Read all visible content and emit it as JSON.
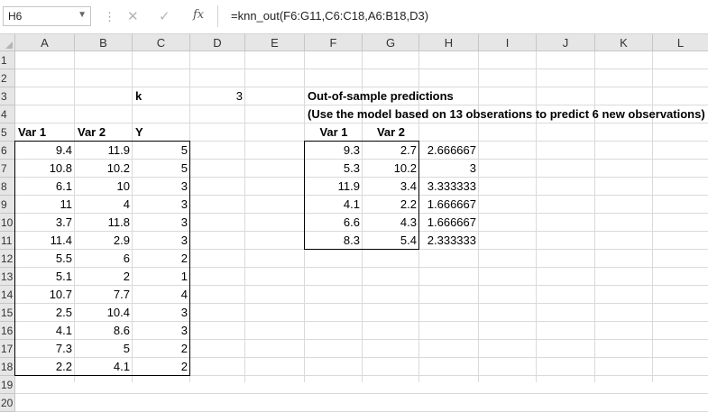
{
  "formula_bar": {
    "name_box": "H6",
    "cancel_icon": "✕",
    "enter_icon": "✓",
    "fx_label": "fx",
    "formula": "=knn_out(F6:G11,C6:C18,A6:B18,D3)"
  },
  "columns": [
    "A",
    "B",
    "C",
    "D",
    "E",
    "F",
    "G",
    "H",
    "I",
    "J",
    "K",
    "L"
  ],
  "rows": [
    "1",
    "2",
    "3",
    "4",
    "5",
    "6",
    "7",
    "8",
    "9",
    "10",
    "11",
    "12",
    "13",
    "14",
    "15",
    "16",
    "17",
    "18",
    "19",
    "20"
  ],
  "labels": {
    "k_label": "k",
    "k_value": "3",
    "title1": "Out-of-sample predictions",
    "title2": "(Use the model based on 13 obserations to predict 6 new observations)"
  },
  "training": {
    "headers": [
      "Var 1",
      "Var 2",
      "Y"
    ],
    "rows": [
      [
        "9.4",
        "11.9",
        "5"
      ],
      [
        "10.8",
        "10.2",
        "5"
      ],
      [
        "6.1",
        "10",
        "3"
      ],
      [
        "11",
        "4",
        "3"
      ],
      [
        "3.7",
        "11.8",
        "3"
      ],
      [
        "11.4",
        "2.9",
        "3"
      ],
      [
        "5.5",
        "6",
        "2"
      ],
      [
        "5.1",
        "2",
        "1"
      ],
      [
        "10.7",
        "7.7",
        "4"
      ],
      [
        "2.5",
        "10.4",
        "3"
      ],
      [
        "4.1",
        "8.6",
        "3"
      ],
      [
        "7.3",
        "5",
        "2"
      ],
      [
        "2.2",
        "4.1",
        "2"
      ]
    ]
  },
  "predictions": {
    "headers": [
      "Var 1",
      "Var 2"
    ],
    "rows": [
      [
        "9.3",
        "2.7",
        "2.666667"
      ],
      [
        "5.3",
        "10.2",
        "3"
      ],
      [
        "11.9",
        "3.4",
        "3.333333"
      ],
      [
        "4.1",
        "2.2",
        "1.666667"
      ],
      [
        "6.6",
        "4.3",
        "1.666667"
      ],
      [
        "8.3",
        "5.4",
        "2.333333"
      ]
    ]
  }
}
